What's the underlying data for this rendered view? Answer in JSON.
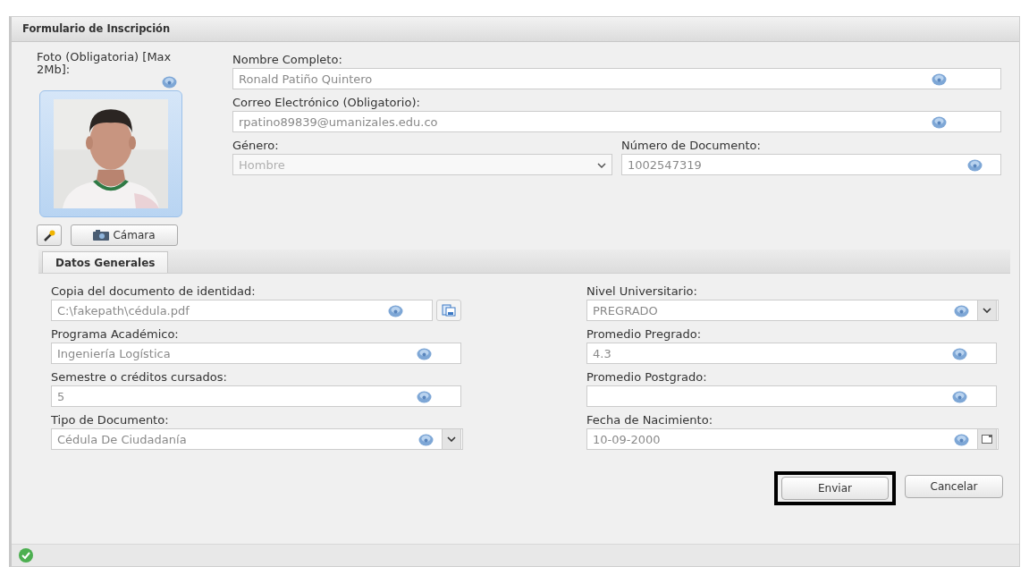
{
  "window": {
    "title": "Formulario de Inscripción"
  },
  "photo": {
    "label": "Foto (Obligatoria) [Max 2Mb]:",
    "help": true,
    "kind": "picture",
    "camera_button": "Cámara"
  },
  "top_rows": [
    [
      {
        "label": "Nombre Completo:",
        "value": "Ronald Patiño Quintero",
        "kind": "text",
        "help": true
      }
    ],
    [
      {
        "label": "Correo Electrónico (Obligatorio):",
        "value": "rpatino89839@umanizales.edu.co",
        "kind": "text",
        "help": true
      }
    ],
    [
      {
        "label": "Género:",
        "value": "Hombre",
        "kind": "select",
        "help": false
      },
      {
        "label": "Número de Documento:",
        "value": "1002547319",
        "kind": "text",
        "help": true
      }
    ]
  ],
  "tabs": [
    {
      "label": "Datos Generales",
      "selected": true
    }
  ],
  "left_fields": [
    {
      "label": "Copia del documento de identidad:",
      "value": "C:\\fakepath\\cédula.pdf",
      "kind": "file",
      "help": true
    },
    {
      "label": "Programa Académico:",
      "value": "Ingeniería Logística",
      "kind": "text",
      "help": true
    },
    {
      "label": "Semestre o créditos cursados:",
      "value": "5",
      "kind": "text",
      "help": true
    },
    {
      "label": "Tipo de Documento:",
      "value": "Cédula De Ciudadanía",
      "kind": "select",
      "help": true
    }
  ],
  "right_fields": [
    {
      "label": "Nivel Universitario:",
      "value": "PREGRADO",
      "kind": "select",
      "help": true
    },
    {
      "label": "Promedio Pregrado:",
      "value": "4.3",
      "kind": "text",
      "help": true
    },
    {
      "label": "Promedio Postgrado:",
      "kind": "text",
      "help": true
    },
    {
      "label": "Fecha de Nacimiento:",
      "value": "10-09-2000",
      "kind": "date",
      "help": true
    }
  ],
  "buttons": [
    {
      "label": "Enviar",
      "highlighted": true
    },
    {
      "label": "Cancelar",
      "highlighted": false
    }
  ],
  "status_bar": {
    "ok": true
  }
}
